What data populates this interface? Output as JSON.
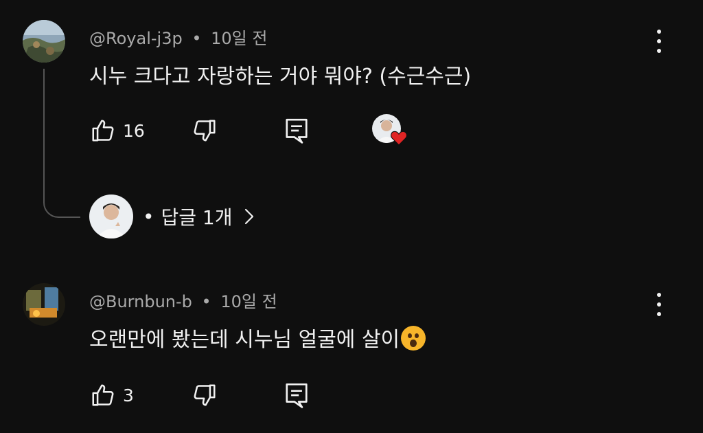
{
  "comments": [
    {
      "author": "@Royal-j3p",
      "time": "10일 전",
      "text": "시누 크다고 자랑하는 거야 뭐야? (수근수근)",
      "likes": "16",
      "replies_label": "답글 1개"
    },
    {
      "author": "@Burnbun-b",
      "time": "10일 전",
      "text": "오랜만에 봤는데 시누님 얼굴에 살이",
      "text_emoji": "hushed-face-emoji",
      "likes": "3"
    }
  ],
  "separator": "•",
  "colors": {
    "background": "#0f0f0f",
    "text": "#f1f1f1",
    "meta": "#aaaaaa",
    "heart": "#e02424"
  }
}
